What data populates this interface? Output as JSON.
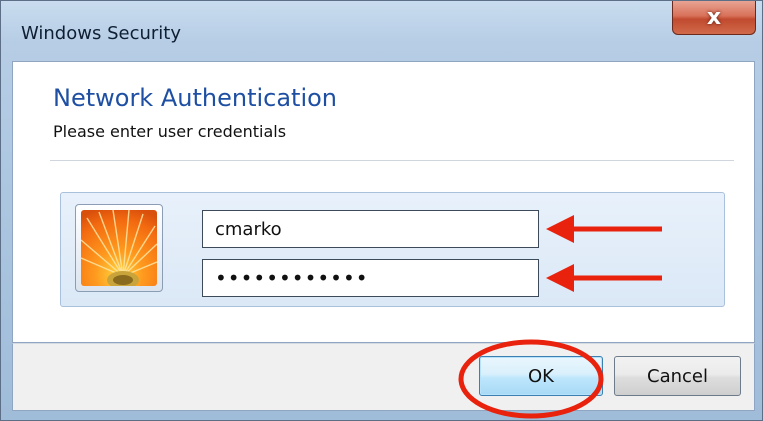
{
  "window": {
    "title": "Windows Security",
    "close_glyph": "x"
  },
  "dialog": {
    "heading": "Network Authentication",
    "subheading": "Please enter user credentials"
  },
  "credentials": {
    "avatar_icon": "flower-user-tile",
    "username_value": "cmarko",
    "password_value": "••••••••••••"
  },
  "buttons": {
    "ok_label": "OK",
    "cancel_label": "Cancel"
  },
  "annotations": {
    "arrow_color": "#e8220c",
    "ring_color": "#e8220c"
  },
  "colors": {
    "heading": "#1e4fa3",
    "close_button": "#c8543a"
  }
}
